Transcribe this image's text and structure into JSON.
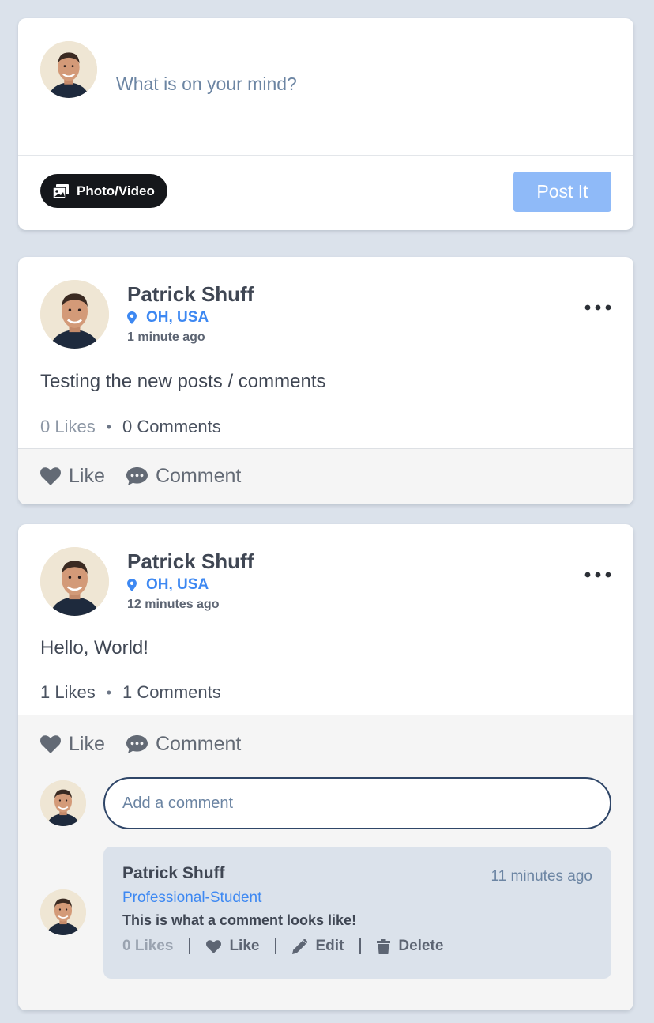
{
  "composer": {
    "placeholder": "What is on your mind?",
    "photo_button": "Photo/Video",
    "post_button": "Post It"
  },
  "posts": [
    {
      "author": "Patrick Shuff",
      "location": "OH, USA",
      "time": "1 minute ago",
      "text": "Testing the new posts / comments",
      "likes": "0 Likes",
      "comments": "0 Comments",
      "like_label": "Like",
      "comment_label": "Comment"
    },
    {
      "author": "Patrick Shuff",
      "location": "OH, USA",
      "time": "12 minutes ago",
      "text": "Hello, World!",
      "likes": "1 Likes",
      "comments": "1 Comments",
      "like_label": "Like",
      "comment_label": "Comment",
      "comment_placeholder": "Add a comment",
      "comment": {
        "author": "Patrick Shuff",
        "time": "11 minutes ago",
        "role": "Professional-Student",
        "text": "This is what a comment looks like!",
        "likes": "0 Likes",
        "like_label": "Like",
        "edit_label": "Edit",
        "delete_label": "Delete"
      }
    }
  ],
  "colors": {
    "background": "#dbe2eb",
    "accent": "#3d88f2",
    "post_button": "#8fbaf8"
  },
  "icons": {
    "photo": "photo-video-icon",
    "pin": "map-pin-icon",
    "more": "more-dots-icon",
    "heart": "heart-icon",
    "comment": "comment-bubble-icon",
    "edit": "pencil-icon",
    "delete": "trash-icon"
  }
}
